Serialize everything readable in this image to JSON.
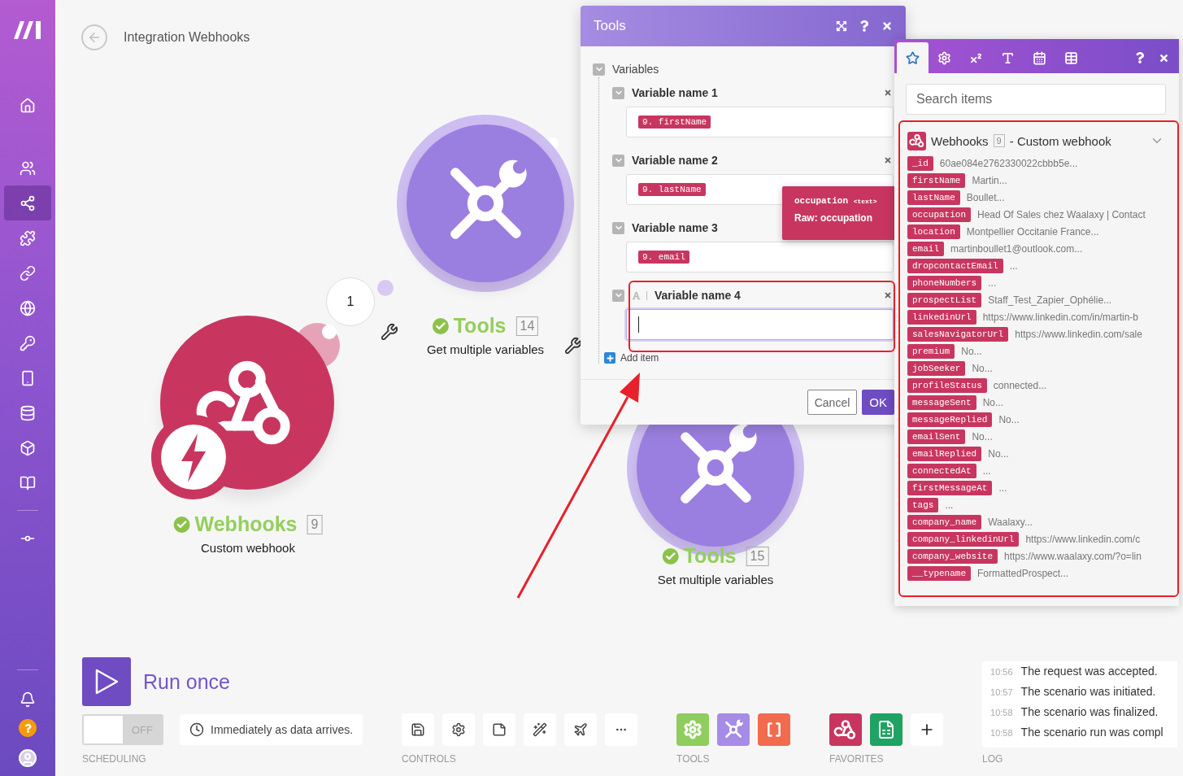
{
  "sidebar": {
    "items": [
      {
        "selected": false
      },
      {
        "selected": false
      },
      {
        "selected": true
      },
      {
        "selected": false
      },
      {
        "selected": false
      },
      {
        "selected": false
      },
      {
        "selected": false
      },
      {
        "selected": false
      },
      {
        "selected": false
      },
      {
        "selected": false
      },
      {
        "selected": false
      },
      {
        "selected": false
      }
    ]
  },
  "header": {
    "title": "Integration Webhooks"
  },
  "canvas": {
    "bundle_count": "1",
    "nodes": [
      {
        "kind": "webhook",
        "success": true,
        "app": "Webhooks",
        "count": "9",
        "subtitle": "Custom webhook"
      },
      {
        "kind": "tools",
        "success": true,
        "app": "Tools",
        "count": "14",
        "subtitle": "Get multiple variables"
      },
      {
        "kind": "tools",
        "success": true,
        "app": "Tools",
        "count": "15",
        "subtitle": "Set multiple variables"
      }
    ]
  },
  "tools_dialog": {
    "title": "Tools",
    "section": {
      "label": "Variables",
      "expanded": true
    },
    "items": [
      {
        "label": "Variable name 1",
        "token": "9. firstName",
        "focused": false
      },
      {
        "label": "Variable name 2",
        "token": "9. lastName",
        "focused": false
      },
      {
        "label": "Variable name 3",
        "token": "9. email",
        "focused": false
      },
      {
        "label": "Variable name 4",
        "focused": true
      }
    ],
    "add_item": "Add item",
    "buttons": {
      "cancel": "Cancel",
      "ok": "OK"
    }
  },
  "tooltip": {
    "name": "occupation",
    "type": "<text>",
    "raw": "Raw: occupation"
  },
  "mapping_panel": {
    "tabs": [
      {
        "selected": true
      },
      {
        "selected": false
      },
      {
        "selected": false
      },
      {
        "selected": false
      },
      {
        "selected": false
      },
      {
        "selected": false
      }
    ],
    "search": {
      "placeholder": "Search items"
    },
    "module": {
      "app": "Webhooks",
      "count": "9",
      "subtitle": "- Custom webhook",
      "expanded": true
    },
    "fields": [
      {
        "key": "_id",
        "value": "60ae084e2762330022cbbb5e..."
      },
      {
        "key": "firstName",
        "value": "Martin..."
      },
      {
        "key": "lastName",
        "value": "Boullet..."
      },
      {
        "key": "occupation",
        "value": "Head Of Sales chez Waalaxy | Contact"
      },
      {
        "key": "location",
        "value": "Montpellier Occitanie France..."
      },
      {
        "key": "email",
        "value": "martinboullet1@outlook.com..."
      },
      {
        "key": "dropcontactEmail",
        "value": "..."
      },
      {
        "key": "phoneNumbers",
        "value": "..."
      },
      {
        "key": "prospectList",
        "value": "Staff_Test_Zapier_Ophélie..."
      },
      {
        "key": "linkedinUrl",
        "value": "https://www.linkedin.com/in/martin-b"
      },
      {
        "key": "salesNavigatorUrl",
        "value": "https://www.linkedin.com/sale"
      },
      {
        "key": "premium",
        "value": "No..."
      },
      {
        "key": "jobSeeker",
        "value": "No..."
      },
      {
        "key": "profileStatus",
        "value": "connected..."
      },
      {
        "key": "messageSent",
        "value": "No..."
      },
      {
        "key": "messageReplied",
        "value": "No..."
      },
      {
        "key": "emailSent",
        "value": "No..."
      },
      {
        "key": "emailReplied",
        "value": "No..."
      },
      {
        "key": "connectedAt",
        "value": "..."
      },
      {
        "key": "firstMessageAt",
        "value": "..."
      },
      {
        "key": "tags",
        "value": "..."
      },
      {
        "key": "company_name",
        "value": "Waalaxy..."
      },
      {
        "key": "company_linkedinUrl",
        "value": "https://www.linkedin.com/c"
      },
      {
        "key": "company_website",
        "value": "https://www.waalaxy.com/?o=lin"
      },
      {
        "key": "__typename",
        "value": "FormattedProspect..."
      }
    ]
  },
  "bottom_bar": {
    "run_once": "Run once",
    "scheduling": {
      "toggle": {
        "on": false,
        "label": "OFF"
      },
      "schedule": "Immediately as data arrives.",
      "label": "SCHEDULING"
    },
    "controls": {
      "label": "CONTROLS"
    },
    "tools": {
      "label": "TOOLS"
    },
    "favorites": {
      "label": "FAVORITES"
    },
    "log": {
      "label": "LOG",
      "entries": [
        {
          "time": "10:56",
          "message": "The request was accepted."
        },
        {
          "time": "10:57",
          "message": "The scenario was initiated."
        },
        {
          "time": "10:58",
          "message": "The scenario was finalized."
        },
        {
          "time": "10:58",
          "message": "The scenario run was compl"
        }
      ]
    }
  }
}
